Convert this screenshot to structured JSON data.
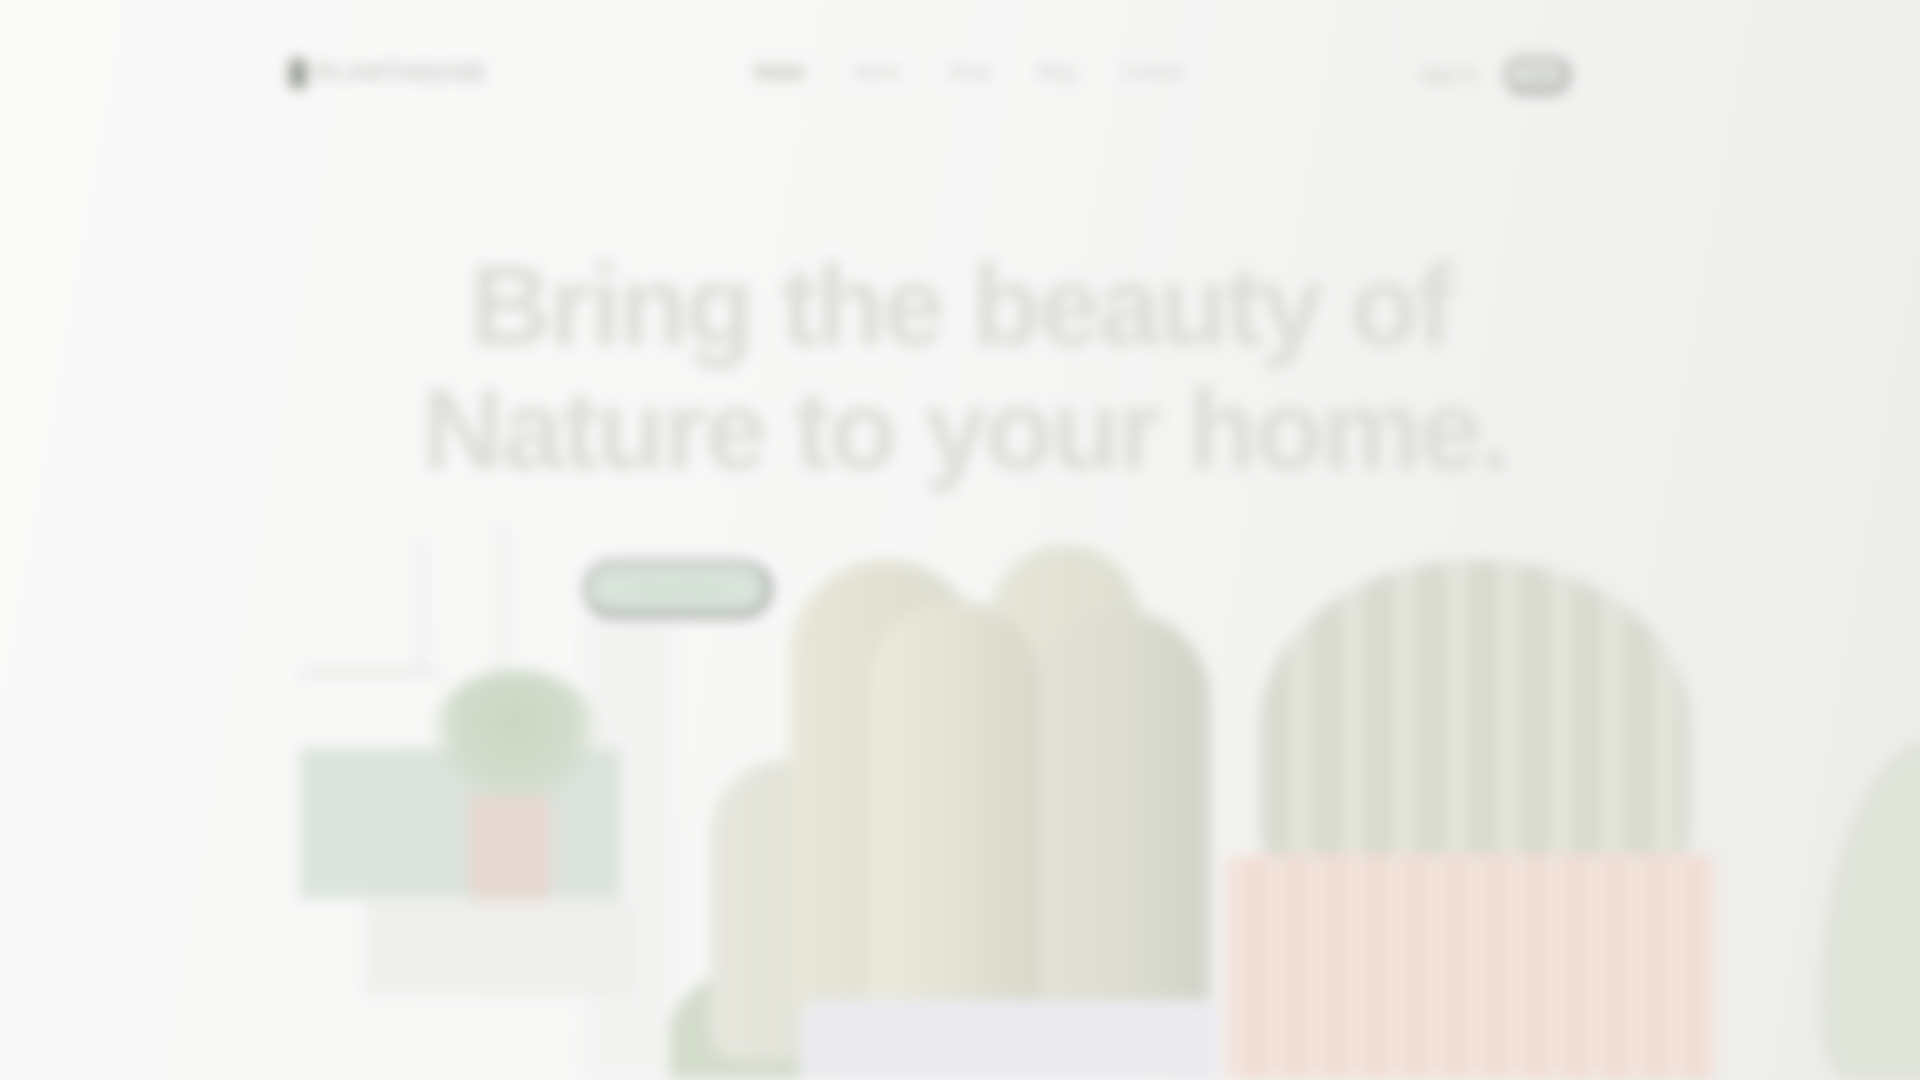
{
  "header": {
    "logo_text": "PLANTHOUSE",
    "nav": [
      {
        "label": "Home"
      },
      {
        "label": "About"
      },
      {
        "label": "Shop"
      },
      {
        "label": "Blog"
      },
      {
        "label": "Contact"
      }
    ],
    "sign_in_label": "Sign In",
    "cart_label": "Cart"
  },
  "hero": {
    "title_line_1": "Bring the beauty of",
    "title_line_2": "Nature to your home.",
    "cta_label": "Shop Now"
  },
  "colors": {
    "background": "#f8f8f7",
    "accent": "#d8e3da",
    "title": "#dcdcd9"
  }
}
